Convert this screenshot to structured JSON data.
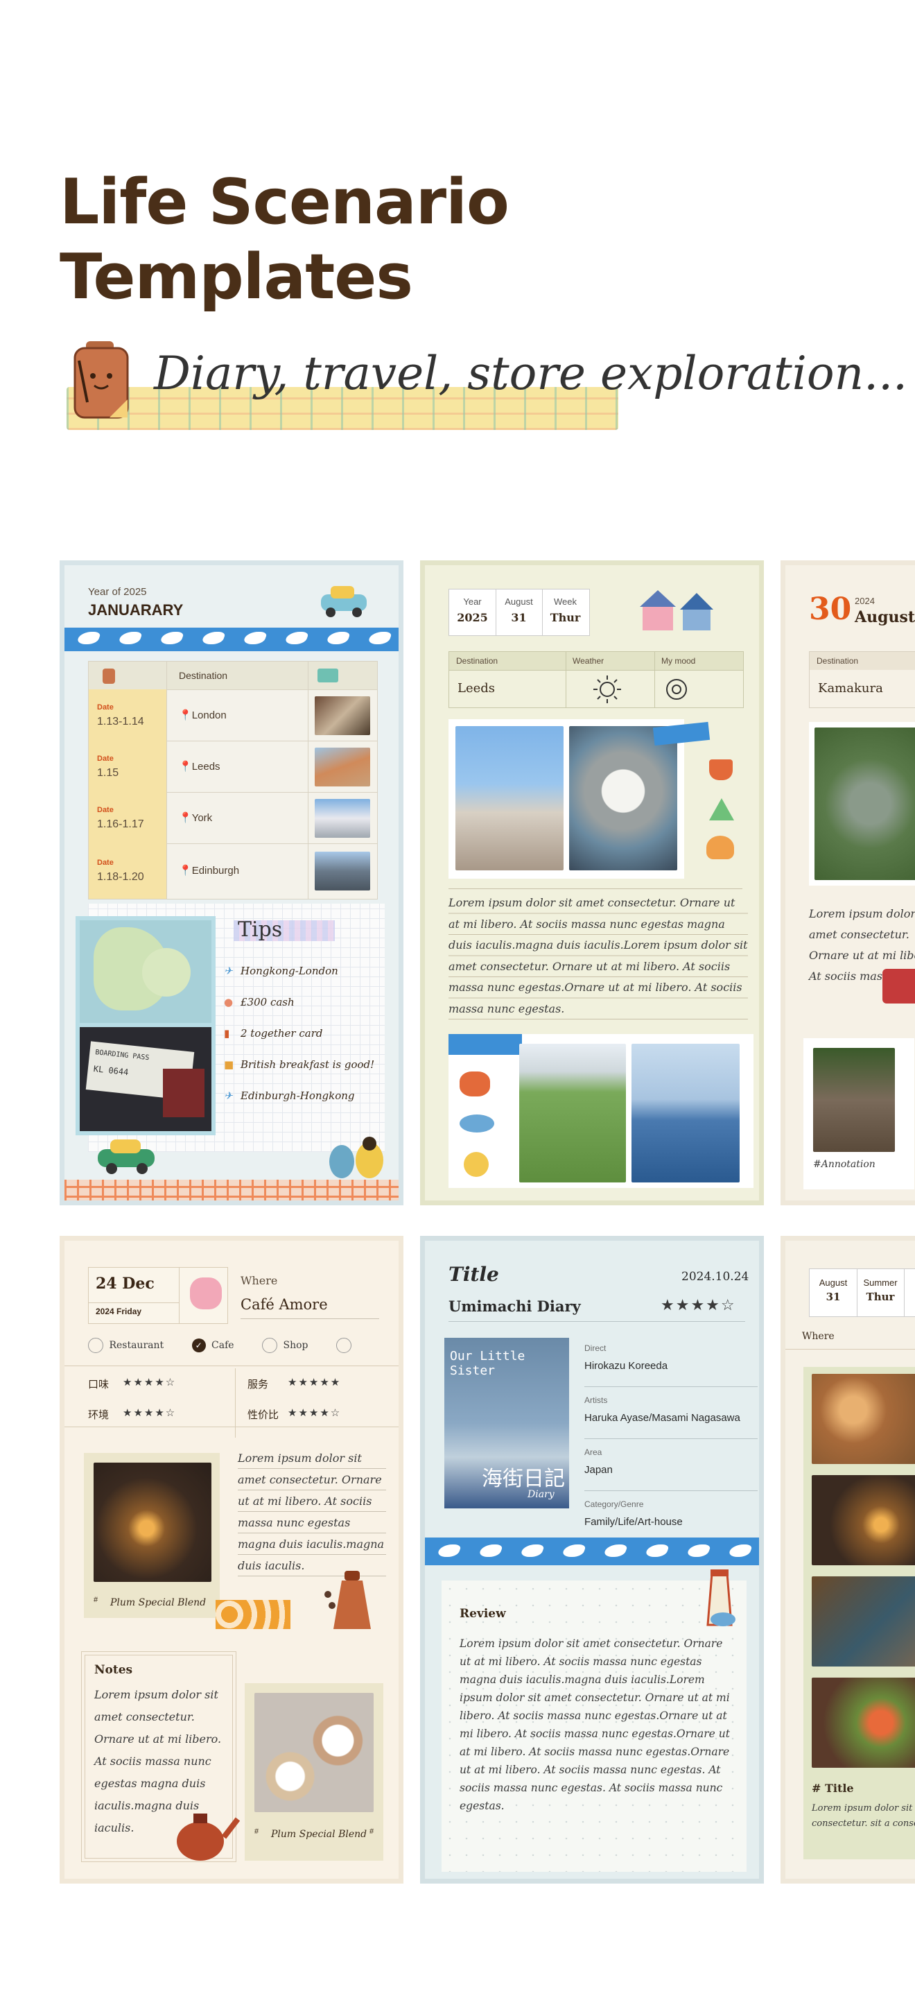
{
  "header": {
    "title_line1": "Life Scenario",
    "title_line2": "Templates",
    "tagline": "Diary, travel, store exploration..."
  },
  "colors": {
    "title": "#4a2f18",
    "accent_blue": "#3d8fd6",
    "accent_orange": "#e35b1b"
  },
  "card1": {
    "year_label": "Year of 2025",
    "month": "JANUARARY",
    "col_destination": "Destination",
    "date_label": "Date",
    "rows": [
      {
        "date": "1.13-1.14",
        "place": "London"
      },
      {
        "date": "1.15",
        "place": "Leeds"
      },
      {
        "date": "1.16-1.17",
        "place": "York"
      },
      {
        "date": "1.18-1.20",
        "place": "Edinburgh"
      }
    ],
    "tips_title": "Tips",
    "tips": [
      "Hongkong-London",
      "£300 cash",
      "2 together card",
      "British breakfast is good!",
      "Edinburgh-Hongkong"
    ],
    "boarding_text": "BOARDING PASS",
    "boarding_code": "KL 0644"
  },
  "card2": {
    "year_label": "Year",
    "year": "2025",
    "month_label": "August",
    "day": "31",
    "week_label": "Week",
    "weekday": "Thur",
    "col_destination": "Destination",
    "col_weather": "Weather",
    "col_mood": "My mood",
    "destination": "Leeds",
    "body": "Lorem ipsum dolor sit amet consectetur. Ornare ut at mi libero. At sociis massa nunc egestas magna duis iaculis.magna duis iaculis.Lorem ipsum dolor sit amet consectetur. Ornare ut at mi libero. At sociis massa nunc egestas.Ornare ut at mi libero. At sociis massa nunc egestas."
  },
  "card3": {
    "day": "30",
    "year": "2024",
    "month": "August",
    "col_destination": "Destination",
    "destination": "Kamakura",
    "body": "Lorem ipsum dolor sit amet consectetur. Ornare ut at mi libero. At sociis massa nunc",
    "annotation": "#Annotation"
  },
  "card4": {
    "date": "24 Dec",
    "sub": "2024 Friday",
    "where_label": "Where",
    "where": "Café Amore",
    "options": [
      "Restaurant",
      "Cafe",
      "Shop"
    ],
    "ratings": [
      {
        "label": "口味",
        "stars": "★★★★☆"
      },
      {
        "label": "服务",
        "stars": "★★★★★"
      },
      {
        "label": "环境",
        "stars": "★★★★☆"
      },
      {
        "label": "性价比",
        "stars": "★★★★☆"
      }
    ],
    "body": "Lorem ipsum dolor sit amet consectetur. Ornare ut at mi libero. At sociis massa nunc egestas magna duis iaculis.magna duis iaculis.",
    "photo_caption": "Plum Special Blend",
    "notes_title": "Notes",
    "notes": "Lorem ipsum dolor sit amet consectetur. Ornare ut at mi libero. At sociis massa nunc egestas magna duis iaculis.magna duis iaculis.",
    "photo2_caption": "Plum Special Blend",
    "hash": "#"
  },
  "card5": {
    "title_label": "Title",
    "date": "2024.10.24",
    "title": "Umimachi Diary",
    "stars": "★★★★☆",
    "poster_text": "Our Little Sister",
    "poster_kanji": "海街日記",
    "poster_sub": "Diary",
    "fields": [
      {
        "label": "Direct",
        "value": "Hirokazu Koreeda"
      },
      {
        "label": "Artists",
        "value": "Haruka Ayase/Masami Nagasawa"
      },
      {
        "label": "Area",
        "value": "Japan"
      },
      {
        "label": "Category/Genre",
        "value": "Family/Life/Art-house"
      }
    ],
    "review_title": "Review",
    "review": "Lorem ipsum dolor sit amet consectetur. Ornare ut at mi libero. At sociis massa nunc egestas magna duis iaculis.magna duis iaculis.Lorem ipsum dolor sit amet consectetur. Ornare ut at mi libero. At sociis massa nunc egestas.Ornare ut at mi libero. At sociis massa nunc egestas.Ornare ut at mi libero. At sociis massa nunc egestas.Ornare ut at mi libero. At sociis massa nunc egestas. At sociis massa nunc egestas. At sociis massa nunc egestas."
  },
  "card6": {
    "month": "August",
    "day": "31",
    "season": "Summer",
    "weekday": "Thur",
    "where_label": "Where",
    "title": "# Title",
    "body": "Lorem ipsum dolor sit amet consectetur. sit a consectetur."
  }
}
